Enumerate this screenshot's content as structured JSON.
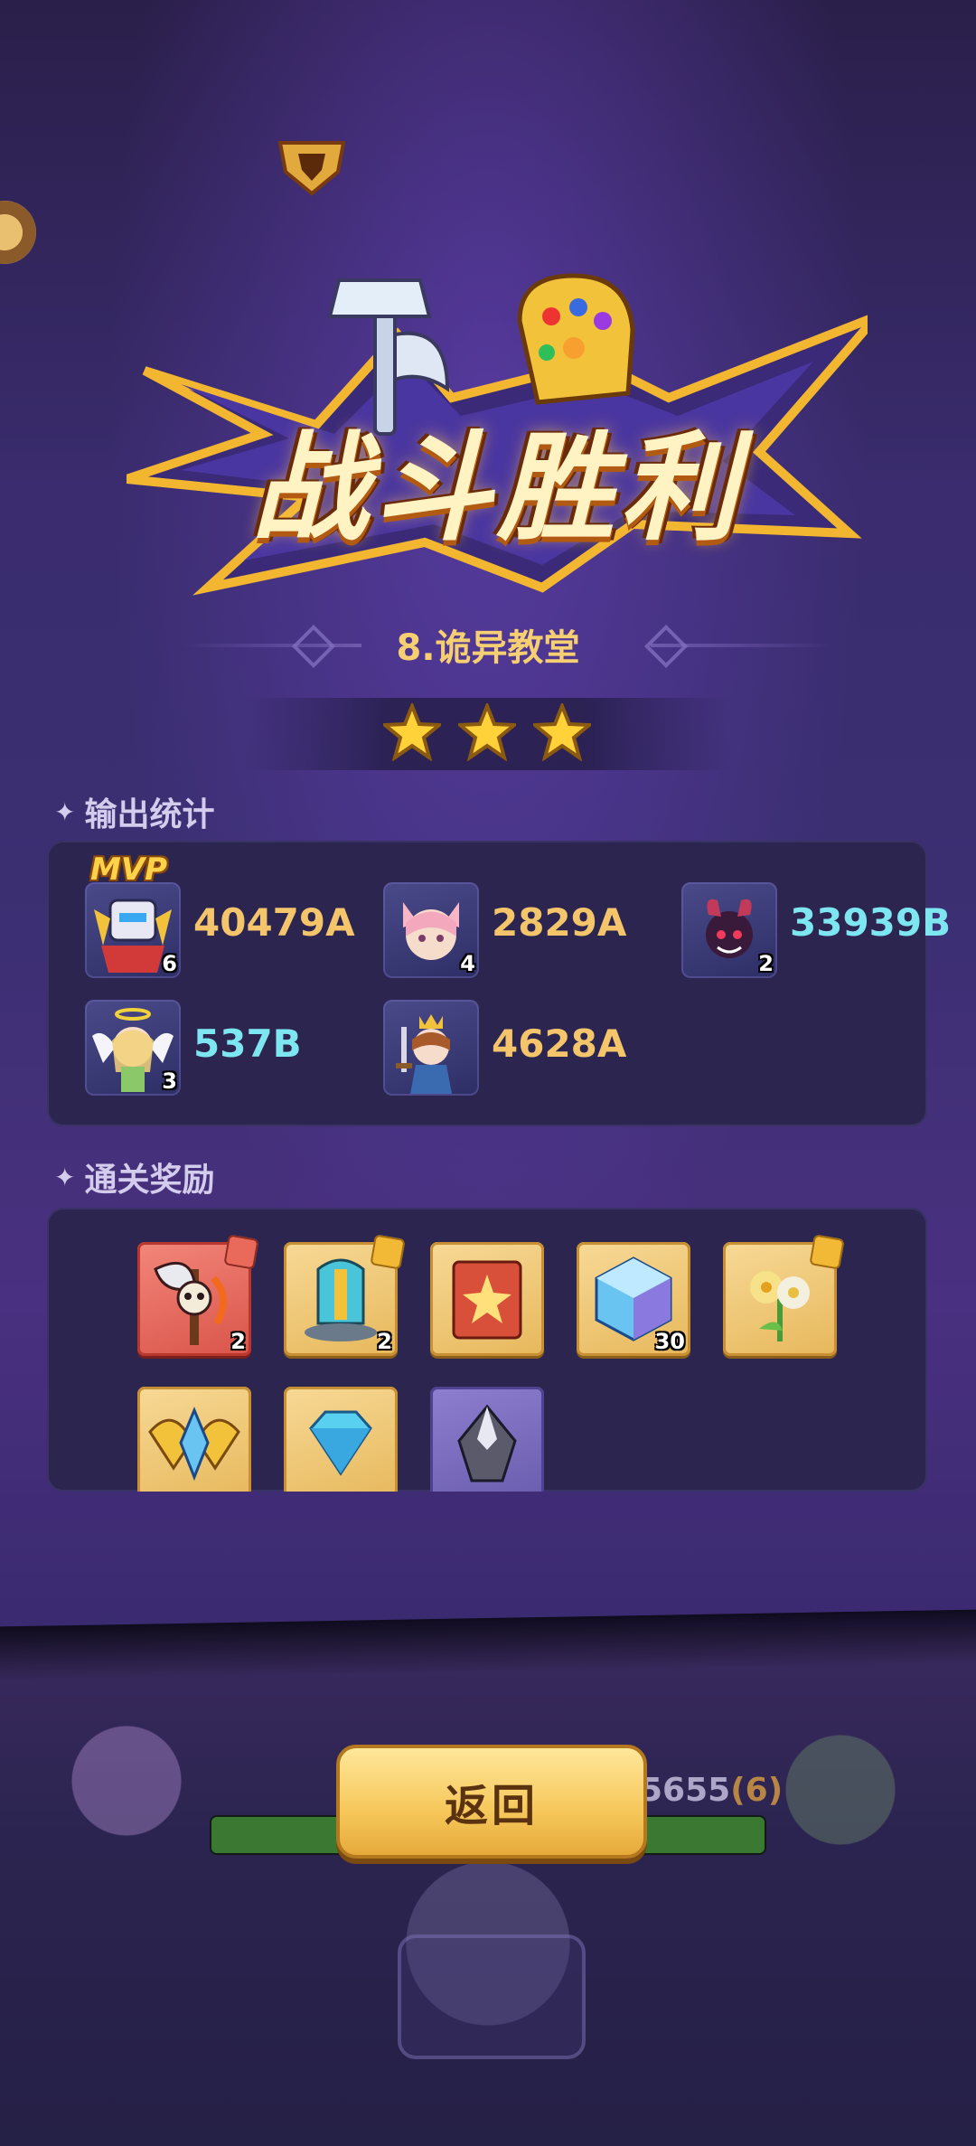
{
  "banner": {
    "title": "战斗胜利"
  },
  "stage": {
    "title": "8.诡异教堂",
    "stars": 3
  },
  "damage_stats": {
    "title": "输出统计",
    "mvp_label": "MVP",
    "heroes": [
      {
        "icon": "robot-mech-hero-icon",
        "level": "6",
        "damage": "40479A",
        "mvp": true
      },
      {
        "icon": "fox-girl-hero-icon",
        "level": "4",
        "damage": "2829A"
      },
      {
        "icon": "demon-hero-icon",
        "level": "2",
        "damage": "33939B"
      },
      {
        "icon": "angel-hero-icon",
        "level": "3",
        "damage": "537B"
      },
      {
        "icon": "king-swordsman-hero-icon",
        "level": "",
        "damage": "4628A"
      }
    ]
  },
  "rewards": {
    "title": "通关奖励",
    "items": [
      {
        "icon": "skull-axe-icon",
        "count": "2"
      },
      {
        "icon": "tower-helmet-icon",
        "count": "2"
      },
      {
        "icon": "spell-book-icon",
        "count": ""
      },
      {
        "icon": "crystal-cube-icon",
        "count": "30"
      },
      {
        "icon": "flower-icon",
        "count": ""
      },
      {
        "icon": "wing-badge-icon",
        "count": ""
      },
      {
        "icon": "diamond-icon",
        "count": ""
      },
      {
        "icon": "stone-shard-icon",
        "count": ""
      }
    ]
  },
  "scene": {
    "hp_text": "5655",
    "hp_level": "(6)"
  },
  "buttons": {
    "return_label": "返回"
  },
  "colors": {
    "gold_text": "#f4c56a",
    "cyan_text": "#7ee6f0",
    "panel_bg": "#2b2550"
  }
}
